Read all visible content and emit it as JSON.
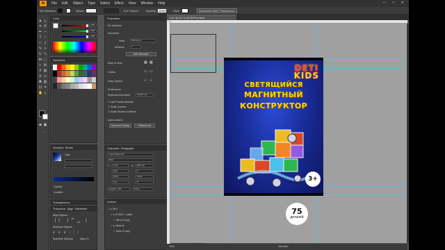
{
  "app": {
    "logo": "Ai",
    "menu": [
      "File",
      "Edit",
      "Object",
      "Type",
      "Select",
      "Effect",
      "View",
      "Window",
      "Help"
    ],
    "window_controls": "— □ ✕"
  },
  "control_bar": {
    "selection_label": "No Selection",
    "stroke_label": "Stroke:",
    "stroke_value": "",
    "brush_label": "5 pt. Round",
    "opacity_label": "Opacity:",
    "opacity_value": "100%",
    "style_label": "Style:",
    "doc_setup_button": "Document Setup",
    "prefs_button": "Preferences"
  },
  "document": {
    "tab_label": "2.ai* @ 50 % (RGB/Preview)",
    "zoom": "50%",
    "status_center": "Selection"
  },
  "panels": {
    "color": {
      "title": "Color",
      "values": [
        "255",
        "255",
        "255"
      ]
    },
    "swatches": {
      "title": "Swatches"
    },
    "properties": {
      "title": "Properties",
      "no_selection": "No Selection",
      "document_label": "Document",
      "units_label": "Units:",
      "units_value": "Millimeters",
      "artboard_label": "Artboard:",
      "artboard_value": "1",
      "edit_artboards": "Edit Artboards",
      "rulers_grids": "Ruler & Grids",
      "guides": "Guides",
      "snap_options": "Snap Options",
      "preferences_label": "Preferences",
      "keyboard_increment_label": "Keyboard Increment:",
      "keyboard_increment_value": "0,3528 mm",
      "checkboxes": [
        "Use Preview Bounds",
        "Scale Corners",
        "Scale Strokes & Effects"
      ],
      "quick_actions": "Quick Actions",
      "document_setup": "Document Setup",
      "preferences_button": "Preferences"
    },
    "gradient": {
      "title": "Gradient",
      "title2": "Stroke",
      "type_label": "Type:",
      "angle_label": "",
      "opacity_label": "Opacity:",
      "location_label": "Location:"
    },
    "character": {
      "title": "Character",
      "title2": "Paragraph",
      "font": "Futura Spec ND",
      "style": "Bold",
      "size": "72 pt",
      "leading": "(86.4 pt)",
      "tracking": "0",
      "kerning": "Auto",
      "scale_v": "100%",
      "scale_h": "100%",
      "baseline": "0 pt",
      "rotation": "0°",
      "lang": "English: USA",
      "aa": "Sharp"
    },
    "transparency": {
      "title": "Transparency"
    },
    "align": {
      "title": "Transform",
      "title2": "Align",
      "title3": "Pathfinder",
      "align_objects": "Align Objects:",
      "distribute_objects": "Distribute Objects:",
      "distribute_spacing": "Distribute Spacing:",
      "align_to": "Align To:"
    },
    "actions": {
      "title": "Actions",
      "items": [
        "Set 1",
        "Hi 2020 - copter",
        "Save A Copy",
        "Instance",
        "Save A Copy"
      ]
    }
  },
  "artwork": {
    "brand_line1": "DETI",
    "brand_line2": "KIDS",
    "headline": [
      "СВЕТЯЩИЙСЯ",
      "МАГНИТНЫЙ",
      "КОНСТРУКТОР"
    ],
    "age": "3+",
    "count_number": "75",
    "count_unit": "деталей"
  }
}
